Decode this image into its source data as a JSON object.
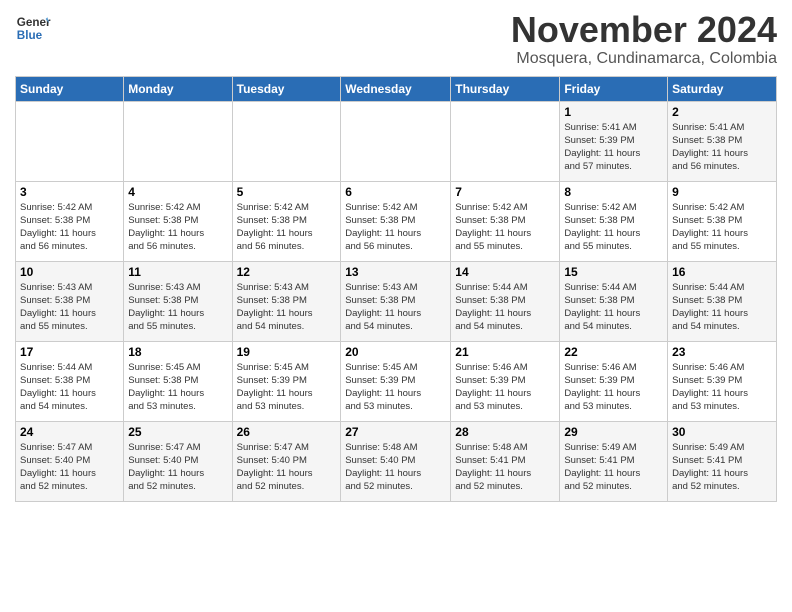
{
  "header": {
    "logo_line1": "General",
    "logo_line2": "Blue",
    "month_title": "November 2024",
    "location": "Mosquera, Cundinamarca, Colombia"
  },
  "weekdays": [
    "Sunday",
    "Monday",
    "Tuesday",
    "Wednesday",
    "Thursday",
    "Friday",
    "Saturday"
  ],
  "weeks": [
    [
      {
        "day": "",
        "info": ""
      },
      {
        "day": "",
        "info": ""
      },
      {
        "day": "",
        "info": ""
      },
      {
        "day": "",
        "info": ""
      },
      {
        "day": "",
        "info": ""
      },
      {
        "day": "1",
        "info": "Sunrise: 5:41 AM\nSunset: 5:39 PM\nDaylight: 11 hours\nand 57 minutes."
      },
      {
        "day": "2",
        "info": "Sunrise: 5:41 AM\nSunset: 5:38 PM\nDaylight: 11 hours\nand 56 minutes."
      }
    ],
    [
      {
        "day": "3",
        "info": "Sunrise: 5:42 AM\nSunset: 5:38 PM\nDaylight: 11 hours\nand 56 minutes."
      },
      {
        "day": "4",
        "info": "Sunrise: 5:42 AM\nSunset: 5:38 PM\nDaylight: 11 hours\nand 56 minutes."
      },
      {
        "day": "5",
        "info": "Sunrise: 5:42 AM\nSunset: 5:38 PM\nDaylight: 11 hours\nand 56 minutes."
      },
      {
        "day": "6",
        "info": "Sunrise: 5:42 AM\nSunset: 5:38 PM\nDaylight: 11 hours\nand 56 minutes."
      },
      {
        "day": "7",
        "info": "Sunrise: 5:42 AM\nSunset: 5:38 PM\nDaylight: 11 hours\nand 55 minutes."
      },
      {
        "day": "8",
        "info": "Sunrise: 5:42 AM\nSunset: 5:38 PM\nDaylight: 11 hours\nand 55 minutes."
      },
      {
        "day": "9",
        "info": "Sunrise: 5:42 AM\nSunset: 5:38 PM\nDaylight: 11 hours\nand 55 minutes."
      }
    ],
    [
      {
        "day": "10",
        "info": "Sunrise: 5:43 AM\nSunset: 5:38 PM\nDaylight: 11 hours\nand 55 minutes."
      },
      {
        "day": "11",
        "info": "Sunrise: 5:43 AM\nSunset: 5:38 PM\nDaylight: 11 hours\nand 55 minutes."
      },
      {
        "day": "12",
        "info": "Sunrise: 5:43 AM\nSunset: 5:38 PM\nDaylight: 11 hours\nand 54 minutes."
      },
      {
        "day": "13",
        "info": "Sunrise: 5:43 AM\nSunset: 5:38 PM\nDaylight: 11 hours\nand 54 minutes."
      },
      {
        "day": "14",
        "info": "Sunrise: 5:44 AM\nSunset: 5:38 PM\nDaylight: 11 hours\nand 54 minutes."
      },
      {
        "day": "15",
        "info": "Sunrise: 5:44 AM\nSunset: 5:38 PM\nDaylight: 11 hours\nand 54 minutes."
      },
      {
        "day": "16",
        "info": "Sunrise: 5:44 AM\nSunset: 5:38 PM\nDaylight: 11 hours\nand 54 minutes."
      }
    ],
    [
      {
        "day": "17",
        "info": "Sunrise: 5:44 AM\nSunset: 5:38 PM\nDaylight: 11 hours\nand 54 minutes."
      },
      {
        "day": "18",
        "info": "Sunrise: 5:45 AM\nSunset: 5:38 PM\nDaylight: 11 hours\nand 53 minutes."
      },
      {
        "day": "19",
        "info": "Sunrise: 5:45 AM\nSunset: 5:39 PM\nDaylight: 11 hours\nand 53 minutes."
      },
      {
        "day": "20",
        "info": "Sunrise: 5:45 AM\nSunset: 5:39 PM\nDaylight: 11 hours\nand 53 minutes."
      },
      {
        "day": "21",
        "info": "Sunrise: 5:46 AM\nSunset: 5:39 PM\nDaylight: 11 hours\nand 53 minutes."
      },
      {
        "day": "22",
        "info": "Sunrise: 5:46 AM\nSunset: 5:39 PM\nDaylight: 11 hours\nand 53 minutes."
      },
      {
        "day": "23",
        "info": "Sunrise: 5:46 AM\nSunset: 5:39 PM\nDaylight: 11 hours\nand 53 minutes."
      }
    ],
    [
      {
        "day": "24",
        "info": "Sunrise: 5:47 AM\nSunset: 5:40 PM\nDaylight: 11 hours\nand 52 minutes."
      },
      {
        "day": "25",
        "info": "Sunrise: 5:47 AM\nSunset: 5:40 PM\nDaylight: 11 hours\nand 52 minutes."
      },
      {
        "day": "26",
        "info": "Sunrise: 5:47 AM\nSunset: 5:40 PM\nDaylight: 11 hours\nand 52 minutes."
      },
      {
        "day": "27",
        "info": "Sunrise: 5:48 AM\nSunset: 5:40 PM\nDaylight: 11 hours\nand 52 minutes."
      },
      {
        "day": "28",
        "info": "Sunrise: 5:48 AM\nSunset: 5:41 PM\nDaylight: 11 hours\nand 52 minutes."
      },
      {
        "day": "29",
        "info": "Sunrise: 5:49 AM\nSunset: 5:41 PM\nDaylight: 11 hours\nand 52 minutes."
      },
      {
        "day": "30",
        "info": "Sunrise: 5:49 AM\nSunset: 5:41 PM\nDaylight: 11 hours\nand 52 minutes."
      }
    ]
  ]
}
